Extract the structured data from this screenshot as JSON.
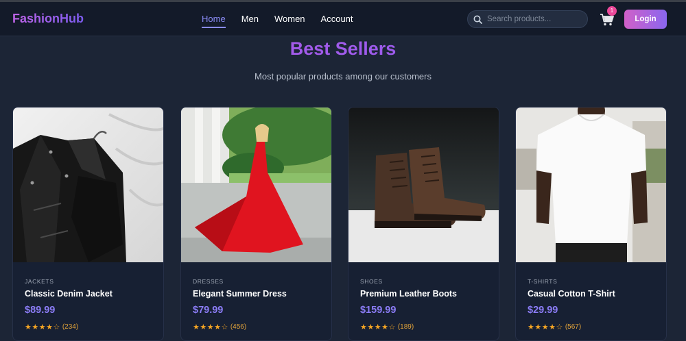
{
  "brand": "FashionHub",
  "nav": {
    "links": [
      {
        "label": "Home",
        "active": true
      },
      {
        "label": "Men",
        "active": false
      },
      {
        "label": "Women",
        "active": false
      },
      {
        "label": "Account",
        "active": false
      }
    ]
  },
  "search": {
    "placeholder": "Search products..."
  },
  "cart": {
    "count": "1"
  },
  "login_label": "Login",
  "section": {
    "title": "Best Sellers",
    "subtitle": "Most popular products among our customers"
  },
  "products": [
    {
      "category": "JACKETS",
      "name": "Classic Denim Jacket",
      "price": "$89.99",
      "stars": "★★★★☆",
      "rating": 4,
      "reviews": "(234)"
    },
    {
      "category": "DRESSES",
      "name": "Elegant Summer Dress",
      "price": "$79.99",
      "stars": "★★★★☆",
      "rating": 4,
      "reviews": "(456)"
    },
    {
      "category": "SHOES",
      "name": "Premium Leather Boots",
      "price": "$159.99",
      "stars": "★★★★☆",
      "rating": 4,
      "reviews": "(189)"
    },
    {
      "category": "T-SHIRTS",
      "name": "Casual Cotton T-Shirt",
      "price": "$29.99",
      "stars": "★★★★☆",
      "rating": 4,
      "reviews": "(567)"
    }
  ],
  "colors": {
    "background": "#1c2536",
    "navbar": "#131a29",
    "accent": "#8b5cf6",
    "brand_gradient_start": "#c064e8",
    "star": "#f5a524",
    "badge": "#ec4899"
  }
}
